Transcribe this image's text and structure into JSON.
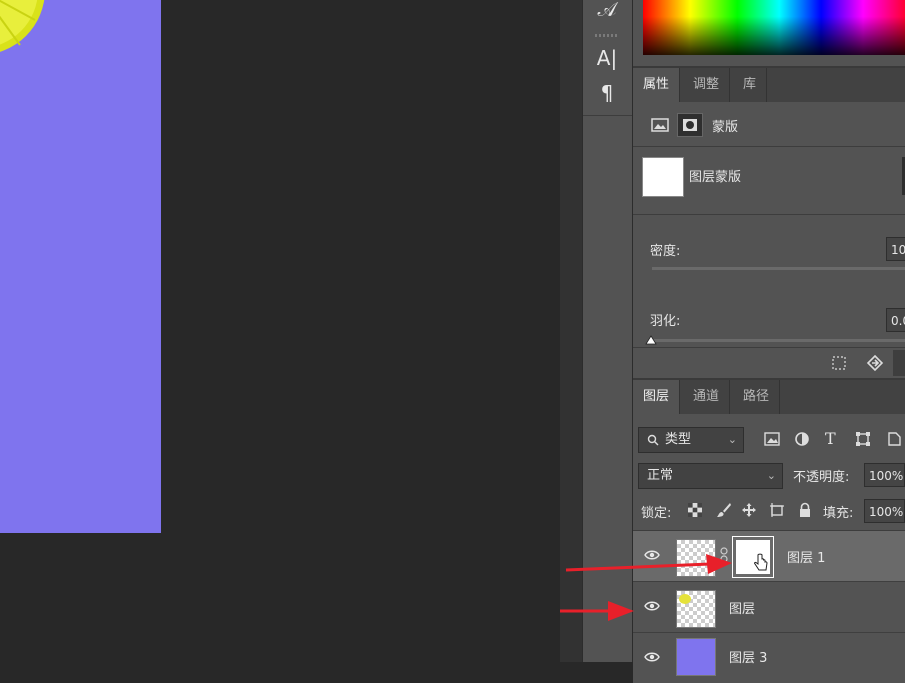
{
  "tools": {
    "character_glyph": "𝒜",
    "text_tool_glyph": "A|",
    "paragraph_glyph": "¶"
  },
  "properties_panel": {
    "tabs": [
      "属性",
      "调整",
      "库"
    ],
    "mask_label": "蒙版",
    "layer_mask_label": "图层蒙版",
    "density_label": "密度:",
    "density_value": "10",
    "feather_label": "羽化:",
    "feather_value": "0.0"
  },
  "layers_panel": {
    "tabs": [
      "图层",
      "通道",
      "路径"
    ],
    "filter_label": "类型",
    "blend_mode": "正常",
    "opacity_label": "不透明度:",
    "opacity_value": "100%",
    "lock_label": "锁定:",
    "fill_label": "填充:",
    "fill_value": "100%",
    "layers": [
      {
        "name": "图层 1",
        "selected": true
      },
      {
        "name": "图层",
        "selected": false
      },
      {
        "name": "图层 3",
        "selected": false
      }
    ]
  },
  "colors": {
    "document_bg": "#7f74ee",
    "arrow": "#e8202a",
    "accent_selected_row": "#6a6a6a"
  }
}
